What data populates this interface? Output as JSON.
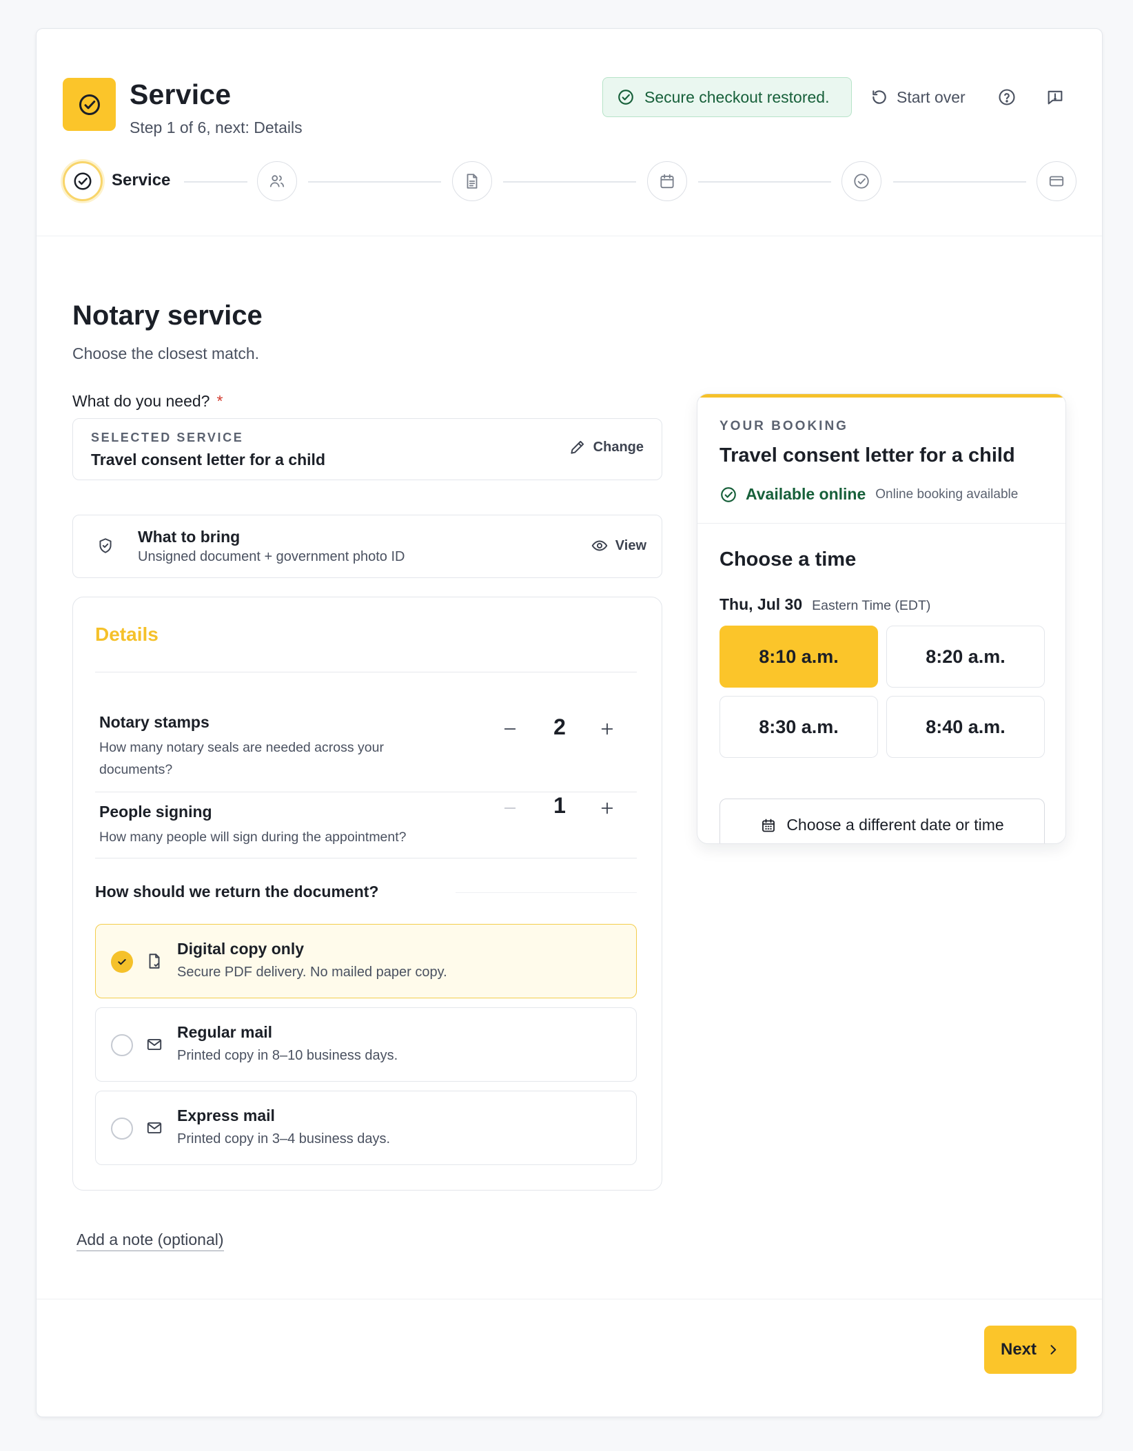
{
  "header": {
    "title": "Service",
    "subtitle": "Step 1 of 6, next: Details",
    "secure_badge": "Secure checkout restored.",
    "start_over": "Start over"
  },
  "stepper": {
    "active_label": "Service",
    "steps": [
      "check-circle-icon",
      "users-icon",
      "document-icon",
      "calendar-icon",
      "check-circle-icon",
      "credit-card-icon"
    ]
  },
  "main": {
    "title": "Notary service",
    "subtitle": "Choose the closest match.",
    "field_label": "What do you need?",
    "required_mark": "*",
    "selected_service": {
      "caption": "SELECTED SERVICE",
      "value": "Travel consent letter for a child",
      "change_label": "Change"
    },
    "what_to_bring": {
      "title": "What to bring",
      "subtitle": "Unsigned document + government photo ID",
      "view_label": "View"
    },
    "details": {
      "title": "Details",
      "notary_stamps": {
        "title": "Notary stamps",
        "subtitle": "How many notary seals are needed across your documents?",
        "value": "2"
      },
      "people_signing": {
        "title": "People signing",
        "subtitle": "How many people will sign during the appointment?",
        "value": "1"
      },
      "return_question": "How should we return the document?",
      "options": [
        {
          "title": "Digital copy only",
          "subtitle": "Secure PDF delivery. No mailed paper copy.",
          "selected": true
        },
        {
          "title": "Regular mail",
          "subtitle": "Printed copy in 8–10 business days.",
          "selected": false
        },
        {
          "title": "Express mail",
          "subtitle": "Printed copy in 3–4 business days.",
          "selected": false
        }
      ]
    },
    "note_link": "Add a note (optional)"
  },
  "booking": {
    "caption": "YOUR BOOKING",
    "title": "Travel consent letter for a child",
    "available": "Available online",
    "available_sub": "Online booking available",
    "choose_title": "Choose a time",
    "date": "Thu, Jul 30",
    "timezone": "Eastern Time (EDT)",
    "slots": [
      "8:10 a.m.",
      "8:20 a.m.",
      "8:30 a.m.",
      "8:40 a.m."
    ],
    "selected_slot": "8:10 a.m.",
    "other_date": "Choose a different date or time"
  },
  "footer": {
    "next_label": "Next"
  },
  "colors": {
    "accent": "#fbc52a",
    "success": "#17603a",
    "success_bg": "#eaf7f0"
  }
}
